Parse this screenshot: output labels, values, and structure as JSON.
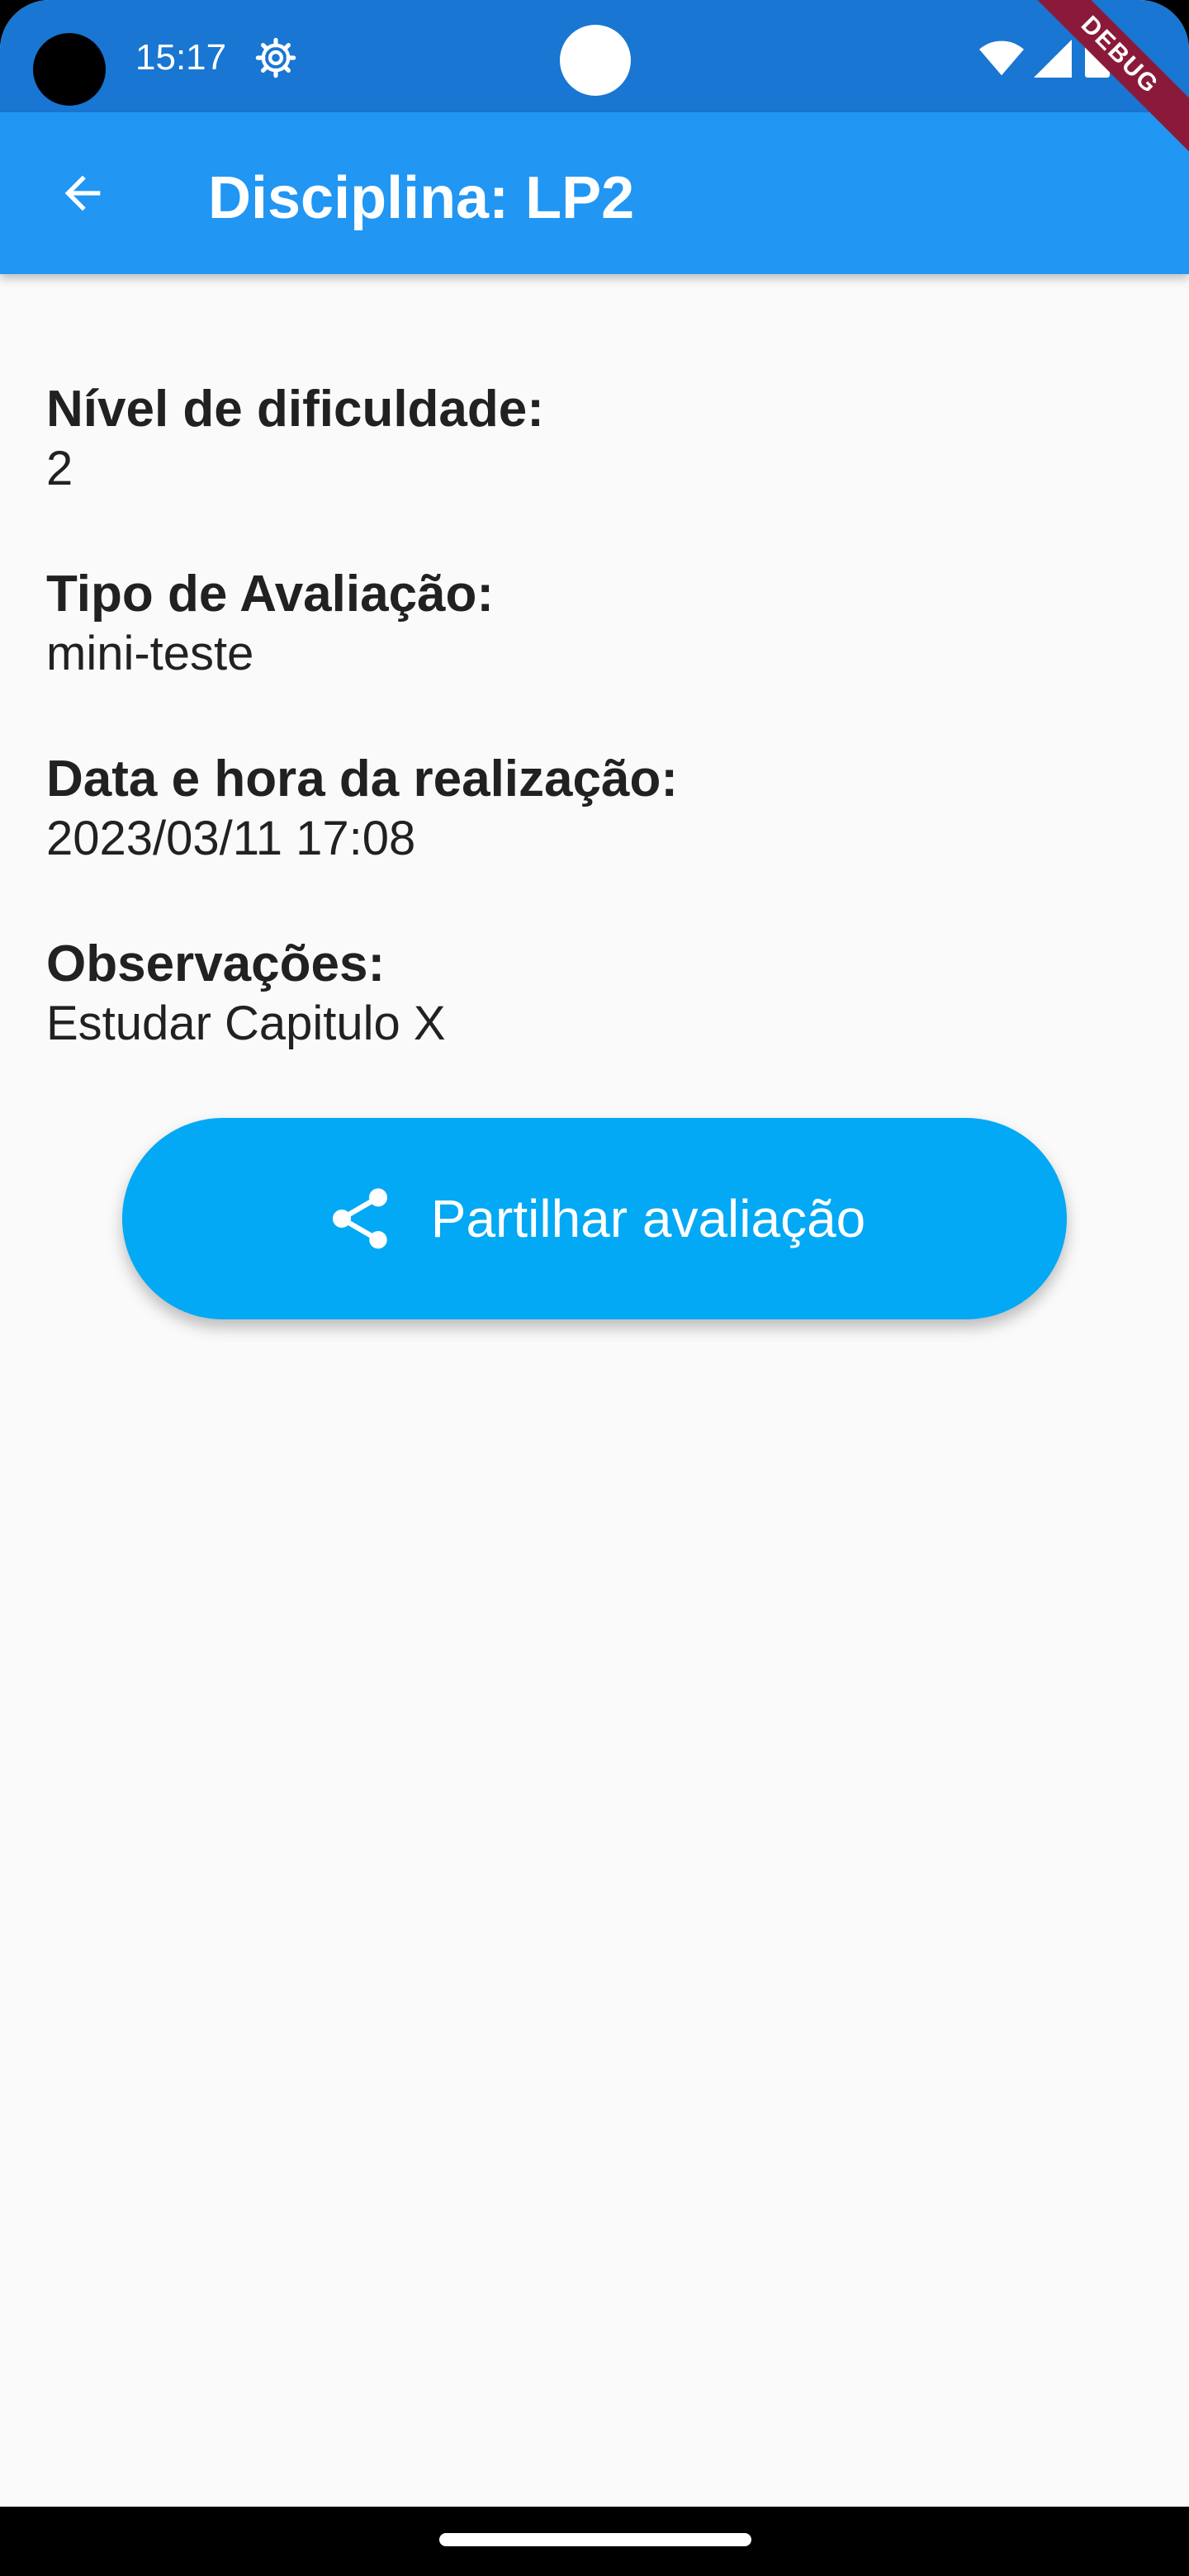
{
  "status_bar": {
    "time": "15:17",
    "icons": [
      "settings-gear-icon",
      "wifi-icon",
      "signal-icon",
      "battery-icon"
    ]
  },
  "debug_banner": "DEBUG",
  "app_bar": {
    "title": "Disciplina: LP2",
    "back_icon": "arrow-back-icon"
  },
  "details": [
    {
      "label": "Nível de dificuldade:",
      "value": "2"
    },
    {
      "label": "Tipo de Avaliação:",
      "value": "mini-teste"
    },
    {
      "label": "Data e hora da realização:",
      "value": "2023/03/11 17:08"
    },
    {
      "label": "Observações:",
      "value": "Estudar Capitulo X"
    }
  ],
  "share_button": {
    "label": "Partilhar avaliação",
    "icon": "share-icon"
  },
  "colors": {
    "status_bar": "#1976d2",
    "app_bar": "#2196f3",
    "button": "#03a9f4",
    "background": "#fafafa",
    "text": "#212121"
  }
}
